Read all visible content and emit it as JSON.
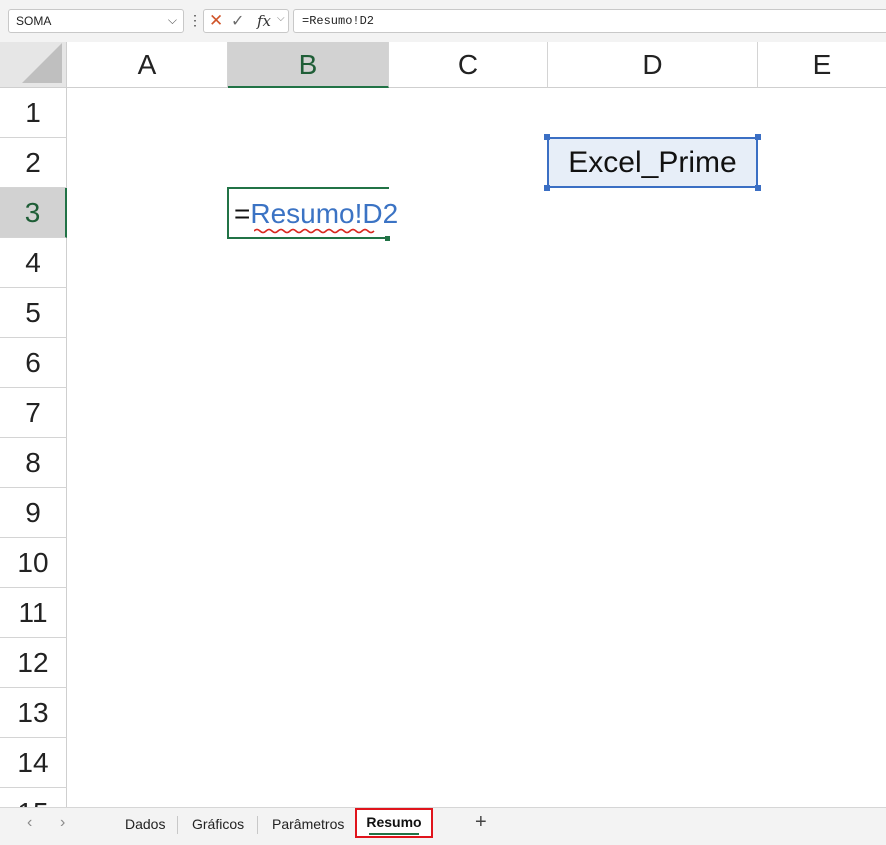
{
  "formula_bar": {
    "name_box": "SOMA",
    "cancel_icon": "close-icon",
    "enter_icon": "check-icon",
    "fx_label": "fx",
    "formula": "=Resumo!D2"
  },
  "columns": [
    "A",
    "B",
    "C",
    "D",
    "E"
  ],
  "rows": [
    "1",
    "2",
    "3",
    "4",
    "5",
    "6",
    "7",
    "8",
    "9",
    "10",
    "11",
    "12",
    "13",
    "14",
    "15"
  ],
  "selected": {
    "column": "B",
    "row": "3"
  },
  "cells": {
    "D2": "Excel_Prime",
    "B3_eq": "=",
    "B3_sheet": "Resumo",
    "B3_ref": "!D2"
  },
  "sheet_tabs": {
    "items": [
      "Dados",
      "Gráficos",
      "Parâmetros"
    ],
    "active": "Resumo",
    "add_label": "+"
  },
  "colors": {
    "accent_green": "#217346",
    "reference_blue": "#3b73c4",
    "highlight_red": "#e0141c"
  }
}
